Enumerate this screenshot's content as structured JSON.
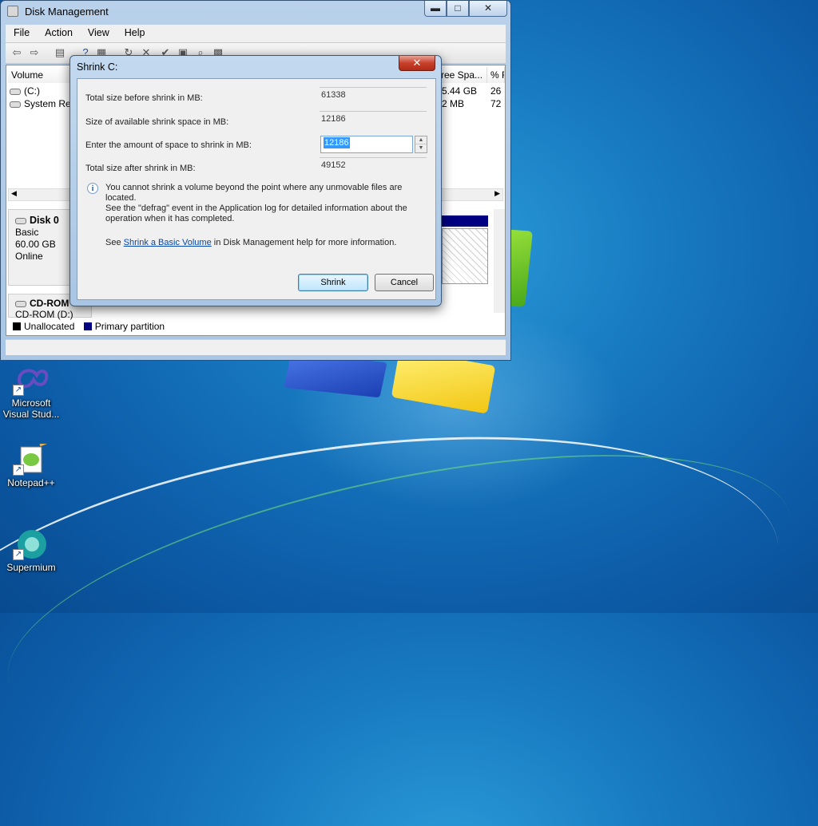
{
  "desktop": {
    "icons": [
      {
        "label_line1": "Microsoft",
        "label_line2": "Visual Stud..."
      },
      {
        "label_line1": "Notepad++",
        "label_line2": ""
      },
      {
        "label_line1": "Supermium",
        "label_line2": ""
      }
    ]
  },
  "window": {
    "title": "Disk Management",
    "buttons": {
      "minimize": "▬",
      "maximize": "□",
      "close": "✕"
    },
    "menu": [
      "File",
      "Action",
      "View",
      "Help"
    ],
    "columns": [
      "Volume",
      "ree Spa...",
      "% F"
    ],
    "volumes": [
      {
        "name": "(C:)",
        "free": "5.44 GB",
        "pct": "26"
      },
      {
        "name": "System Res",
        "free": "2 MB",
        "pct": "72"
      }
    ],
    "disk0": {
      "name": "Disk 0",
      "type": "Basic",
      "size": "60.00 GB",
      "status": "Online"
    },
    "cdrom": {
      "name": "CD-ROM",
      "sub": "CD-ROM (D:)"
    },
    "legend": {
      "unallocated": "Unallocated",
      "primary": "Primary partition",
      "unallocated_color": "#000000",
      "primary_color": "#000080"
    }
  },
  "dialog": {
    "title": "Shrink C:",
    "close_label": "✕",
    "fields": [
      {
        "label": "Total size before shrink in MB:",
        "value": "61338"
      },
      {
        "label": "Size of available shrink space in MB:",
        "value": "12186"
      },
      {
        "label": "Enter the amount of space to shrink in MB:",
        "value": "12186"
      },
      {
        "label": "Total size after shrink in MB:",
        "value": "49152"
      }
    ],
    "info_line1": "You cannot shrink a volume beyond the point where any unmovable files are located.",
    "info_line2": "See the \"defrag\" event in the Application log for detailed information about the",
    "info_line3": "operation when it has completed.",
    "see_prefix": "See ",
    "see_link": "Shrink a Basic Volume",
    "see_suffix": " in Disk Management help for more information.",
    "shrink_label": "Shrink",
    "cancel_label": "Cancel"
  }
}
